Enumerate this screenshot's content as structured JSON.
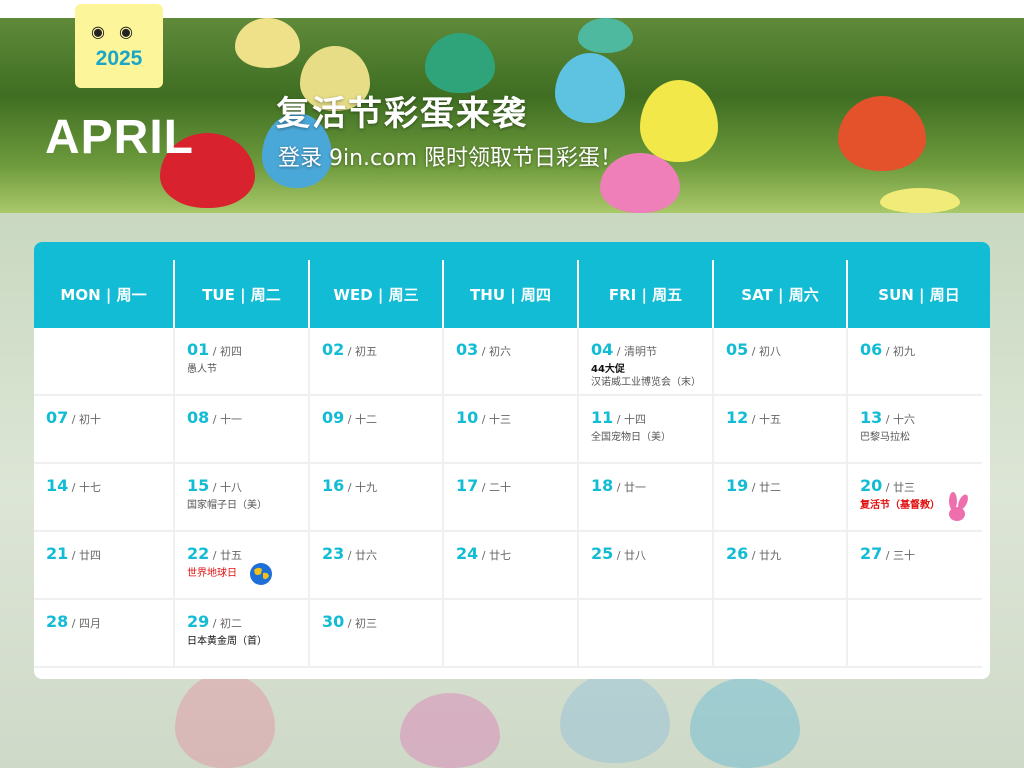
{
  "header": {
    "year": "2025",
    "month": "APRIL",
    "title": "复活节彩蛋来袭",
    "subtitle": "登录 9in.com 限时领取节日彩蛋！"
  },
  "weekdays": [
    "MON | 周一",
    "TUE | 周二",
    "WED | 周三",
    "THU | 周四",
    "FRI | 周五",
    "SAT | 周六",
    "SUN | 周日"
  ],
  "colors": {
    "accent": "#12bcd4",
    "holiday": "#e01010"
  },
  "weeks": [
    [
      null,
      {
        "day": "01",
        "lunar": "初四",
        "events": [
          {
            "text": "愚人节"
          }
        ]
      },
      {
        "day": "02",
        "lunar": "初五"
      },
      {
        "day": "03",
        "lunar": "初六"
      },
      {
        "day": "04",
        "lunar": "清明节",
        "events": [
          {
            "text": "44大促",
            "style": "black bold"
          },
          {
            "text": "汉诺威工业博览会（末）"
          }
        ]
      },
      {
        "day": "05",
        "lunar": "初八"
      },
      {
        "day": "06",
        "lunar": "初九"
      }
    ],
    [
      {
        "day": "07",
        "lunar": "初十"
      },
      {
        "day": "08",
        "lunar": "十一"
      },
      {
        "day": "09",
        "lunar": "十二"
      },
      {
        "day": "10",
        "lunar": "十三"
      },
      {
        "day": "11",
        "lunar": "十四",
        "events": [
          {
            "text": "全国宠物日（美）"
          }
        ]
      },
      {
        "day": "12",
        "lunar": "十五"
      },
      {
        "day": "13",
        "lunar": "十六",
        "events": [
          {
            "text": "巴黎马拉松"
          }
        ]
      }
    ],
    [
      {
        "day": "14",
        "lunar": "十七"
      },
      {
        "day": "15",
        "lunar": "十八",
        "events": [
          {
            "text": "国家帽子日（美）"
          }
        ]
      },
      {
        "day": "16",
        "lunar": "十九"
      },
      {
        "day": "17",
        "lunar": "二十"
      },
      {
        "day": "18",
        "lunar": "廿一"
      },
      {
        "day": "19",
        "lunar": "廿二"
      },
      {
        "day": "20",
        "lunar": "廿三",
        "events": [
          {
            "text": "复活节（基督教）",
            "style": "red bold"
          }
        ],
        "icon": "bunny-icon"
      }
    ],
    [
      {
        "day": "21",
        "lunar": "廿四"
      },
      {
        "day": "22",
        "lunar": "廿五",
        "events": [
          {
            "text": "世界地球日",
            "style": "red"
          }
        ],
        "icon": "globe-icon"
      },
      {
        "day": "23",
        "lunar": "廿六"
      },
      {
        "day": "24",
        "lunar": "廿七"
      },
      {
        "day": "25",
        "lunar": "廿八"
      },
      {
        "day": "26",
        "lunar": "廿九"
      },
      {
        "day": "27",
        "lunar": "三十"
      }
    ],
    [
      {
        "day": "28",
        "lunar": "四月"
      },
      {
        "day": "29",
        "lunar": "初二",
        "events": [
          {
            "text": "日本黄金周（首）",
            "style": "black"
          }
        ]
      },
      {
        "day": "30",
        "lunar": "初三"
      },
      null,
      null,
      null,
      null
    ]
  ]
}
